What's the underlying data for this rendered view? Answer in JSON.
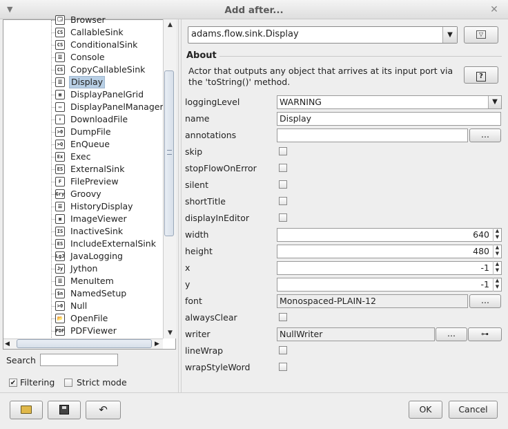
{
  "window": {
    "title": "Add after..."
  },
  "tree": {
    "items": [
      {
        "icon": "🗔",
        "label": "Browser"
      },
      {
        "icon": "CS",
        "label": "CallableSink"
      },
      {
        "icon": "CS",
        "label": "ConditionalSink"
      },
      {
        "icon": "☰",
        "label": "Console"
      },
      {
        "icon": "CS",
        "label": "CopyCallableSink"
      },
      {
        "icon": "☰",
        "label": "Display",
        "selected": true
      },
      {
        "icon": "▦",
        "label": "DisplayPanelGrid"
      },
      {
        "icon": "▭",
        "label": "DisplayPanelManager"
      },
      {
        "icon": "⬇",
        "label": "DownloadFile"
      },
      {
        "icon": ">0",
        "label": "DumpFile"
      },
      {
        "icon": ">Q",
        "label": "EnQueue"
      },
      {
        "icon": "Ex",
        "label": "Exec"
      },
      {
        "icon": "ES",
        "label": "ExternalSink"
      },
      {
        "icon": "F",
        "label": "FilePreview"
      },
      {
        "icon": "Gry",
        "label": "Groovy"
      },
      {
        "icon": "☰",
        "label": "HistoryDisplay"
      },
      {
        "icon": "▣",
        "label": "ImageViewer"
      },
      {
        "icon": "IS",
        "label": "InactiveSink"
      },
      {
        "icon": "ES",
        "label": "IncludeExternalSink"
      },
      {
        "icon": "LgJ",
        "label": "JavaLogging"
      },
      {
        "icon": "Jy",
        "label": "Jython"
      },
      {
        "icon": "☰",
        "label": "MenuItem"
      },
      {
        "icon": "$n",
        "label": "NamedSetup"
      },
      {
        "icon": ">0",
        "label": "Null"
      },
      {
        "icon": "📂",
        "label": "OpenFile"
      },
      {
        "icon": "PDF",
        "label": "PDFViewer"
      }
    ]
  },
  "search": {
    "label": "Search",
    "value": ""
  },
  "options": {
    "filtering_label": "Filtering",
    "strict_label": "Strict mode",
    "filtering_checked": true,
    "strict_checked": false
  },
  "class_selector": {
    "value": "adams.flow.sink.Display"
  },
  "about": {
    "title": "About",
    "text": "Actor that outputs any object that arrives at its input port via the 'toString()' method."
  },
  "props": {
    "loggingLevel": {
      "label": "loggingLevel",
      "value": "WARNING"
    },
    "name": {
      "label": "name",
      "value": "Display"
    },
    "annotations": {
      "label": "annotations",
      "value": ""
    },
    "skip": {
      "label": "skip"
    },
    "stopFlowOnError": {
      "label": "stopFlowOnError"
    },
    "silent": {
      "label": "silent"
    },
    "shortTitle": {
      "label": "shortTitle"
    },
    "displayInEditor": {
      "label": "displayInEditor"
    },
    "width": {
      "label": "width",
      "value": "640"
    },
    "height": {
      "label": "height",
      "value": "480"
    },
    "x": {
      "label": "x",
      "value": "-1"
    },
    "y": {
      "label": "y",
      "value": "-1"
    },
    "font": {
      "label": "font",
      "value": "Monospaced-PLAIN-12"
    },
    "alwaysClear": {
      "label": "alwaysClear"
    },
    "writer": {
      "label": "writer",
      "value": "NullWriter"
    },
    "lineWrap": {
      "label": "lineWrap"
    },
    "wrapStyleWord": {
      "label": "wrapStyleWord"
    }
  },
  "buttons": {
    "ellipsis": "...",
    "ok": "OK",
    "cancel": "Cancel"
  },
  "icons": {
    "help": "?",
    "open": "folder-open-icon",
    "save": "save-icon",
    "undo": "undo-icon"
  }
}
